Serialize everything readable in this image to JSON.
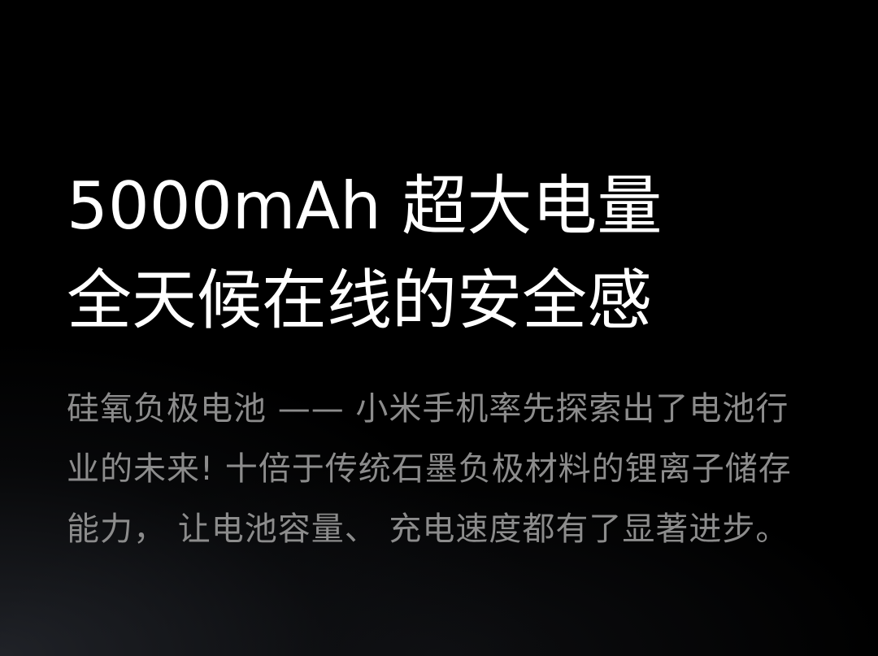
{
  "headline": {
    "line1": "5000mAh 超大电量",
    "line2": "全天候在线的安全感"
  },
  "description": "硅氧负极电池 —— 小米手机率先探索出了电池行业的未来! 十倍于传统石墨负极材料的锂离子储存能力， 让电池容量、 充电速度都有了显著进步。",
  "colors": {
    "background": "#000000",
    "headline": "#ffffff",
    "description": "#8c8c8c"
  }
}
